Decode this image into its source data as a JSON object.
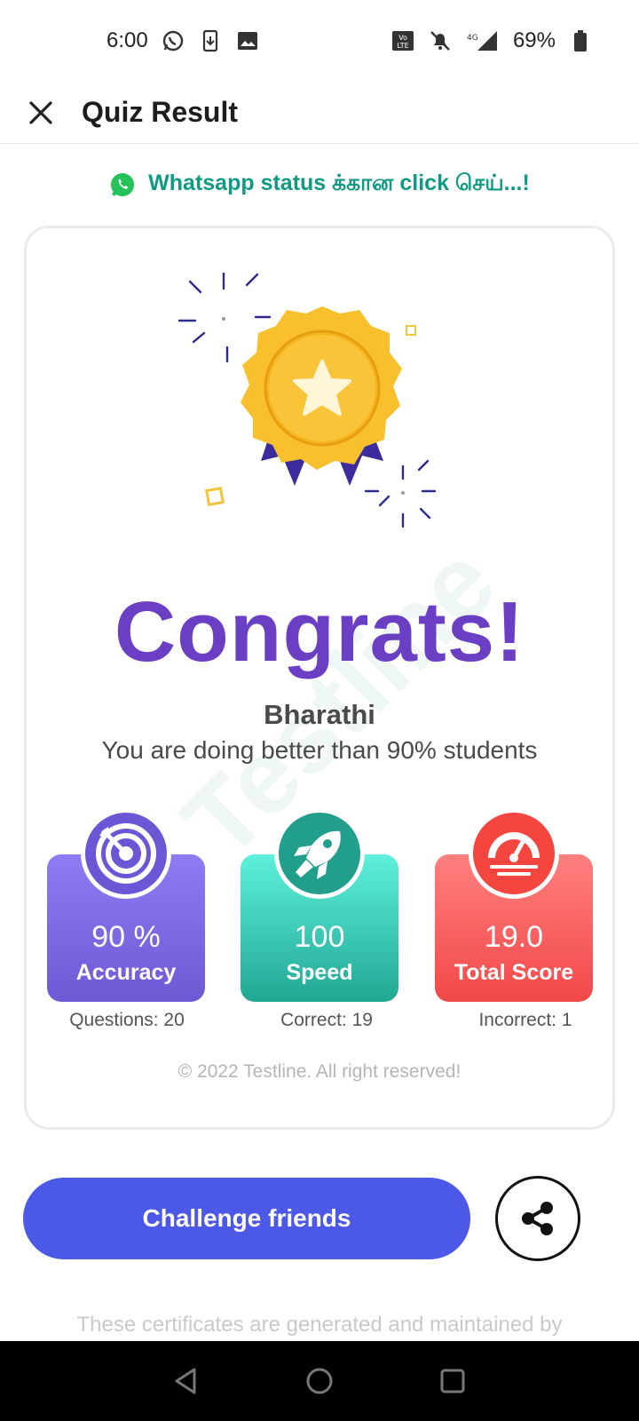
{
  "status_bar": {
    "time": "6:00",
    "battery": "69%",
    "network": "4G",
    "icons": [
      "whatsapp-icon",
      "download-icon",
      "gallery-icon",
      "volte-icon",
      "mute-icon",
      "signal-icon",
      "battery-icon"
    ]
  },
  "header": {
    "title": "Quiz Result",
    "close_icon": "close-icon"
  },
  "whatsapp_link": {
    "text": "Whatsapp status க்கான click செய்...!",
    "icon": "whatsapp-icon"
  },
  "result_card": {
    "watermark": "Testline",
    "congrats": "Congrats!",
    "user_name": "Bharathi",
    "message": "You are doing better than 90% students",
    "stats": [
      {
        "value": "90 %",
        "label": "Accuracy",
        "icon": "target-icon",
        "color": "#6f58d4"
      },
      {
        "value": "100",
        "label": "Speed",
        "icon": "rocket-icon",
        "color": "#20a794"
      },
      {
        "value": "19.0",
        "label": "Total Score",
        "icon": "speedometer-icon",
        "color": "#f24848"
      }
    ],
    "footers": [
      {
        "text": "Questions: 20"
      },
      {
        "text": "Correct: 19"
      },
      {
        "text": "Incorrect: 1"
      }
    ],
    "copyright": "© 2022 Testline. All right reserved!"
  },
  "actions": {
    "challenge_label": "Challenge friends",
    "share_icon": "share-icon"
  },
  "footer_note": "These certificates are generated and maintained by",
  "colors": {
    "accent": "#4c58e6",
    "congrats": "#6a3fc4",
    "whatsapp_link": "#0f9a84"
  }
}
